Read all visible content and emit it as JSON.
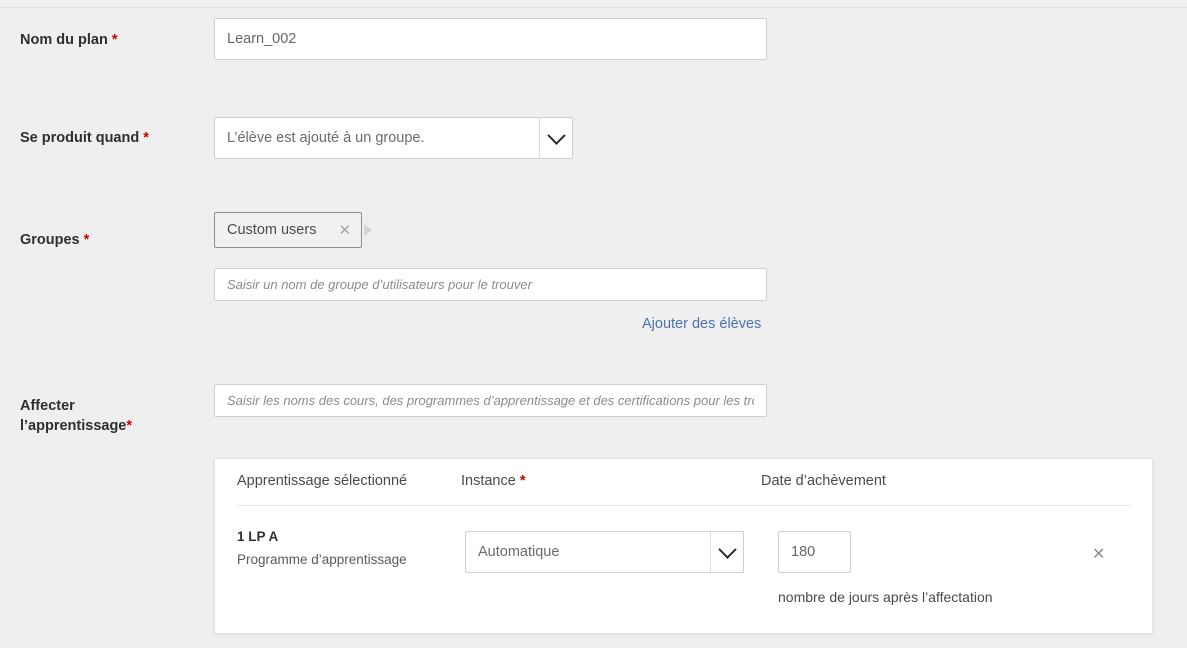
{
  "form": {
    "plan_name": {
      "label": "Nom du plan",
      "required_marker": "*",
      "value": "Learn_002"
    },
    "trigger": {
      "label": "Se produit quand",
      "required_marker": "*",
      "value": "L’élève est ajouté à un groupe.",
      "chevron_icon": "chevron-down-icon"
    },
    "groups": {
      "label": "Groupes",
      "required_marker": "*",
      "chips": [
        {
          "label": "Custom users",
          "remove_icon": "close-icon"
        }
      ],
      "overflow_icon": "caret-right-icon",
      "search_placeholder": "Saisir un nom de groupe d’utilisateurs pour le trouver",
      "search_value": "",
      "add_learners_link": "Ajouter des élèves"
    },
    "assign_learning": {
      "label_line1": "Affecter",
      "label_line2": "l’apprentissage",
      "required_marker": "*",
      "search_placeholder": "Saisir les noms des cours, des programmes d’apprentissage et des certifications pour les trouver",
      "search_value": ""
    }
  },
  "table": {
    "columns": {
      "selected_learning": "Apprentissage sélectionné",
      "instance": "Instance",
      "instance_required_marker": "*",
      "completion_date": "Date d’achèvement"
    },
    "rows": [
      {
        "title": "1 LP A",
        "subtitle": "Programme d’apprentissage",
        "instance_value": "Automatique",
        "instance_chevron_icon": "chevron-down-icon",
        "days_value": "180",
        "days_helper": "nombre de jours après l’affectation",
        "remove_icon": "close-icon"
      }
    ]
  },
  "colors": {
    "page_background": "#efefef",
    "panel_background": "#ffffff",
    "required_red": "#cc0000",
    "link_blue": "#4c72b0",
    "input_border": "#cfcfcf",
    "chip_border": "#8e8e8e"
  }
}
